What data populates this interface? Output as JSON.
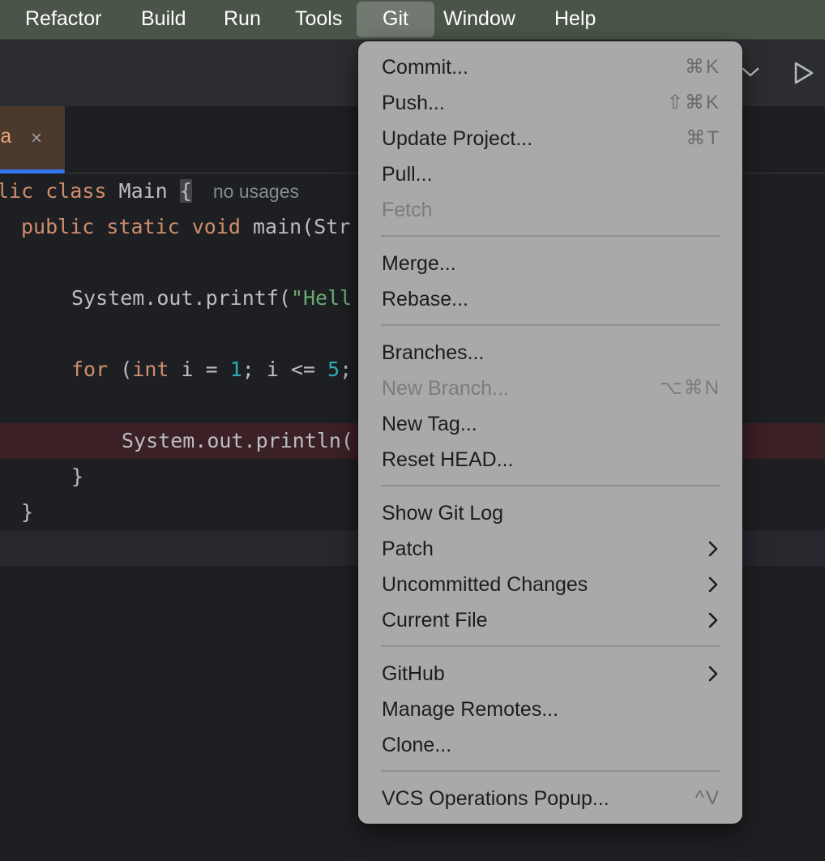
{
  "menubar": {
    "items": [
      {
        "label": "Refactor"
      },
      {
        "label": "Build"
      },
      {
        "label": "Run"
      },
      {
        "label": "Tools"
      },
      {
        "label": "Git",
        "active": true
      },
      {
        "label": "Window"
      },
      {
        "label": "Help"
      }
    ]
  },
  "toolbar": {
    "icons": [
      "chevron-down-icon",
      "run-icon"
    ]
  },
  "tab": {
    "label": "a",
    "close": "×"
  },
  "editor": {
    "hint_no_usages": "no usages",
    "lines": {
      "l1_kw": "lic class ",
      "l1_name": "Main ",
      "l1_brace": "{",
      "l2_kw": "public static void ",
      "l2_rest": "main(Str",
      "l3": "System.out.printf(",
      "l3_str": "\"Hell",
      "l4_for": "for",
      "l4_a": " (",
      "l4_int": "int",
      "l4_b": " i = ",
      "l4_n1": "1",
      "l4_c": "; i <= ",
      "l4_n5": "5",
      "l4_d": ";",
      "l5": "System.out.println(",
      "l6": "}",
      "l7": "}"
    }
  },
  "git_menu": {
    "commit": {
      "label": "Commit...",
      "shortcut": "⌘K"
    },
    "push": {
      "label": "Push...",
      "shortcut": "⇧⌘K"
    },
    "update": {
      "label": "Update Project...",
      "shortcut": "⌘T"
    },
    "pull": {
      "label": "Pull..."
    },
    "fetch": {
      "label": "Fetch"
    },
    "merge": {
      "label": "Merge..."
    },
    "rebase": {
      "label": "Rebase..."
    },
    "branches": {
      "label": "Branches..."
    },
    "new_branch": {
      "label": "New Branch...",
      "shortcut": "⌥⌘N"
    },
    "new_tag": {
      "label": "New Tag..."
    },
    "reset_head": {
      "label": "Reset HEAD..."
    },
    "show_log": {
      "label": "Show Git Log"
    },
    "patch": {
      "label": "Patch"
    },
    "uncommitted": {
      "label": "Uncommitted Changes"
    },
    "current_file": {
      "label": "Current File"
    },
    "github": {
      "label": "GitHub"
    },
    "manage_remotes": {
      "label": "Manage Remotes..."
    },
    "clone": {
      "label": "Clone..."
    },
    "vcs_popup": {
      "label": "VCS Operations Popup...",
      "shortcut": "^V"
    }
  }
}
